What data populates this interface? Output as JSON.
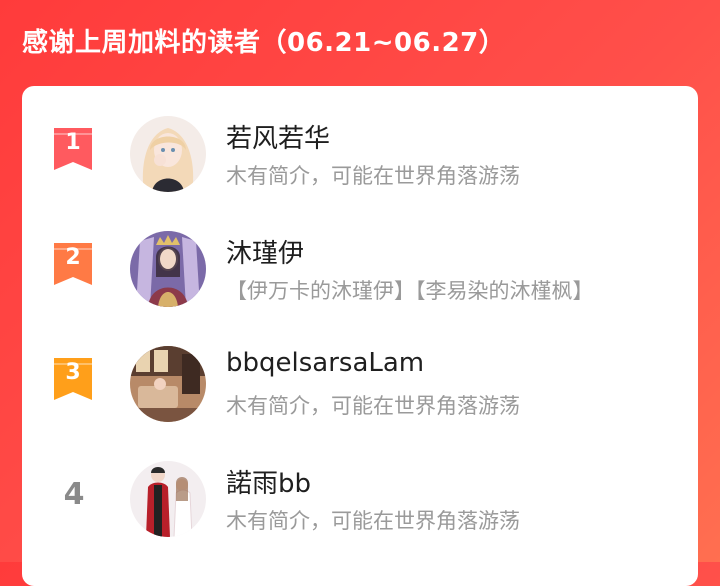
{
  "header": {
    "title": "感谢上周加料的读者（06.21~06.27）"
  },
  "colors": {
    "rank1": "#ff5a5f",
    "rank2": "#ff7a45",
    "rank3": "#ff9f1a",
    "rank_plain": "#8a8a8a"
  },
  "readers": [
    {
      "rank": "1",
      "name": "若风若华",
      "bio": "木有简介，可能在世界角落游荡",
      "avatar_icon": "anime-girl-avatar"
    },
    {
      "rank": "2",
      "name": "沐瑾伊",
      "bio": "【伊万卡的沐瑾伊】【李易染的沐槿枫】",
      "avatar_icon": "princess-throne-avatar"
    },
    {
      "rank": "3",
      "name": "bbqelsarsaLam",
      "bio": "木有简介，可能在世界角落游荡",
      "avatar_icon": "room-scene-avatar"
    },
    {
      "rank": "4",
      "name": "諾雨bb",
      "bio": "木有简介，可能在世界角落游荡",
      "avatar_icon": "couple-avatar"
    }
  ]
}
